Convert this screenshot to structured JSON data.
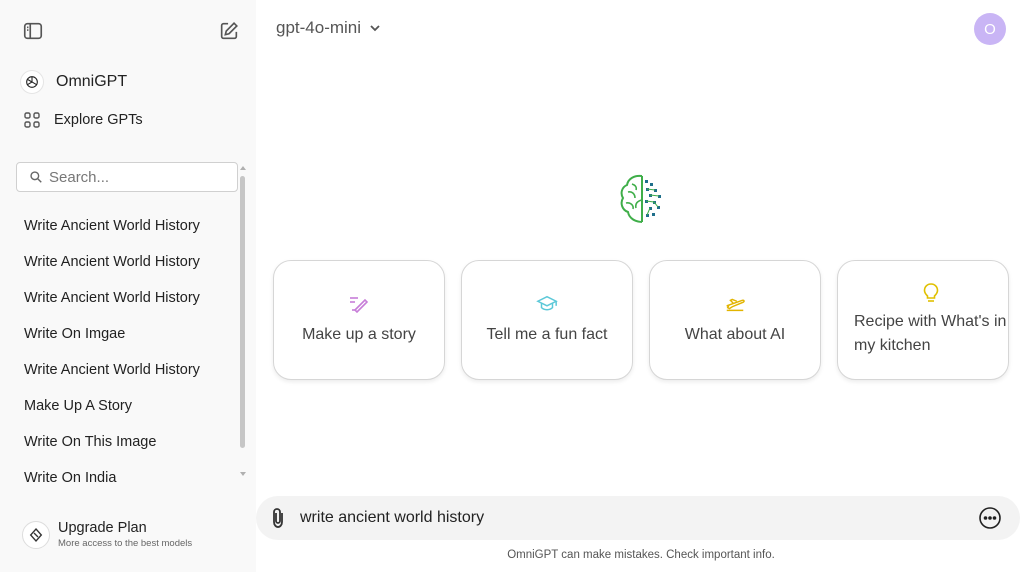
{
  "sidebar": {
    "brand_name": "OmniGPT",
    "explore_label": "Explore GPTs",
    "search_placeholder": "Search...",
    "history": [
      "Write Ancient World History",
      "Write Ancient World History",
      "Write Ancient World History",
      "Write On Imgae",
      "Write Ancient World History",
      "Make Up A Story",
      "Write On This Image",
      "Write On India"
    ],
    "upgrade_title": "Upgrade Plan",
    "upgrade_subtitle": "More access to the best models"
  },
  "header": {
    "model_name": "gpt-4o-mini",
    "avatar_letter": "O"
  },
  "suggestions": [
    {
      "label": "Make up a story",
      "icon": "pen-icon"
    },
    {
      "label": "Tell me a fun fact",
      "icon": "graduation-cap-icon"
    },
    {
      "label": "What about AI",
      "icon": "plane-icon"
    },
    {
      "label": "Recipe with What's in my kitchen",
      "icon": "lightbulb-icon"
    }
  ],
  "composer": {
    "value": "write ancient world history"
  },
  "disclaimer": "OmniGPT can make mistakes. Check important info.",
  "colors": {
    "sidebar_bg": "#f9f9f9",
    "avatar_bg": "#c9b5f5",
    "card_pen": "#c77dd8",
    "card_cap": "#5bc8d8",
    "card_plane": "#e2b400",
    "card_bulb": "#e0c000",
    "brain_green": "#3fae49",
    "brain_blue": "#1f6f8b"
  }
}
